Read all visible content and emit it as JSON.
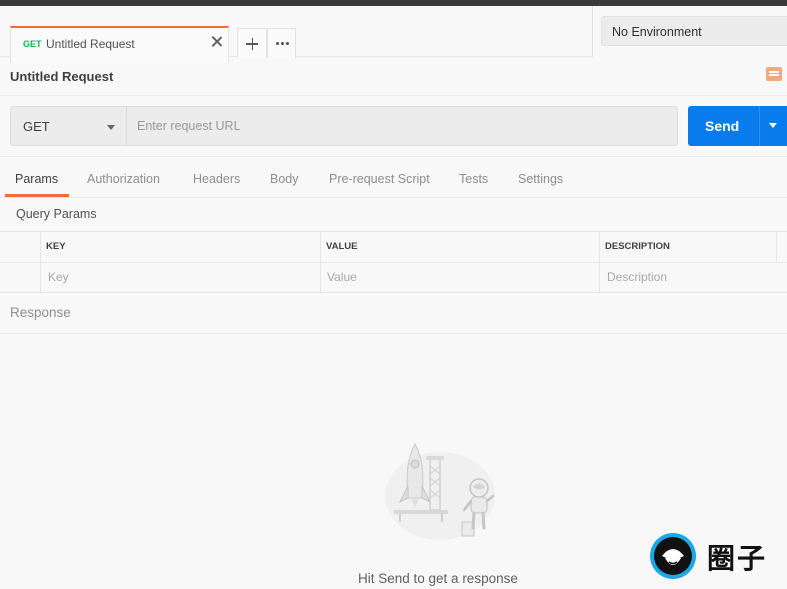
{
  "tabs": {
    "active": {
      "method": "GET",
      "title": "Untitled Request"
    },
    "new_tab_icon": "plus-icon",
    "more_icon": "ellipsis-icon"
  },
  "environment": {
    "selected": "No Environment"
  },
  "request": {
    "title": "Untitled Request",
    "method": "GET",
    "url_placeholder": "Enter request URL",
    "send_label": "Send"
  },
  "subtabs": [
    "Params",
    "Authorization",
    "Headers",
    "Body",
    "Pre-request Script",
    "Tests",
    "Settings"
  ],
  "query_params": {
    "label": "Query Params",
    "columns": [
      "KEY",
      "VALUE",
      "DESCRIPTION"
    ],
    "placeholders": [
      "Key",
      "Value",
      "Description"
    ]
  },
  "response": {
    "label": "Response",
    "empty_message": "Hit Send to get a response"
  },
  "watermark": {
    "text": "圈子"
  },
  "colors": {
    "accent": "#f26b3a",
    "send": "#097bed",
    "get_method": "#0cbb52"
  }
}
